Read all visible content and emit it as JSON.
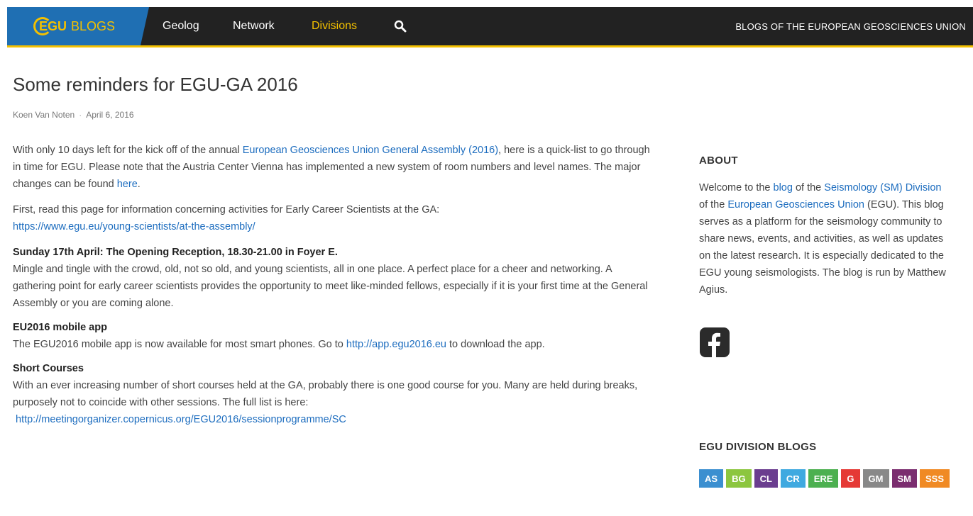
{
  "nav": {
    "logo_egu": "EGU",
    "logo_blogs": "BLOGS",
    "items": [
      {
        "label": "Geolog"
      },
      {
        "label": "Network"
      },
      {
        "label": "Divisions"
      }
    ],
    "right_text": "BLOGS OF THE EUROPEAN GEOSCIENCES UNION",
    "accent_color": "#f3c000",
    "brand_color": "#1f6fb3"
  },
  "post": {
    "title": "Some reminders for EGU-GA 2016",
    "author": "Koen Van Noten",
    "separator": "·",
    "date": "April 6, 2016",
    "intro": {
      "t1": "With only 10 days left for the kick off of the annual ",
      "link1": "European Geosciences Union General Assembly (2016)",
      "t2": ", here is a quick-list to go through in time for EGU. Please note that the Austria Center Vienna has implemented a new system of room numbers and level names. The major changes can be found ",
      "link2": "here",
      "t3": "."
    },
    "first": {
      "t1": "First, read this page for information concerning activities for Early Career Scientists at the GA:",
      "link": "https://www.egu.eu/young-scientists/at-the-assembly/"
    },
    "sections": [
      {
        "heading": "Sunday 17th April: The Opening Reception, 18.30-21.00 in Foyer E.",
        "text": "Mingle and tingle with the crowd, old, not so old, and young scientists, all in one place. A perfect place for a cheer and networking. A gathering point for early career scientists provides the opportunity to meet like-minded fellows, especially if it is your first time at the General Assembly or you are coming alone."
      },
      {
        "heading": "EU2016 mobile app",
        "t1": "The EGU2016 mobile app is now available for most smart phones. Go to ",
        "link": "http://app.egu2016.eu",
        "t2": "  to download the app."
      },
      {
        "heading": "Short Courses",
        "text": "With an ever increasing number of short courses held at the GA,  probably there is one good course for you. Many are held during breaks, purposely not to coincide with other sessions. The full list is here:",
        "link": "http://meetingorganizer.copernicus.org/EGU2016/sessionprogramme/SC"
      }
    ]
  },
  "sidebar": {
    "about_heading": "ABOUT",
    "about": {
      "t1": "Welcome to the ",
      "link1": "blog",
      "t2": " of the ",
      "link2": "Seismology (SM) Division",
      "t3": " of the ",
      "link3": "European Geosciences Union",
      "t4": " (EGU). This blog serves as a platform for the seismology community to share news, events, and activities, as well as updates on the latest research. It is especially dedicated to the EGU young seismologists. The blog is run by Matthew Agius."
    },
    "facebook_icon": "facebook-icon",
    "division_heading": "EGU DIVISION BLOGS",
    "divisions": [
      {
        "label": "AS",
        "color": "#3b8fd0"
      },
      {
        "label": "BG",
        "color": "#8cc63f"
      },
      {
        "label": "CL",
        "color": "#6a3d8f"
      },
      {
        "label": "CR",
        "color": "#3fa9e0"
      },
      {
        "label": "ERE",
        "color": "#4cb050"
      },
      {
        "label": "G",
        "color": "#e53935"
      },
      {
        "label": "GM",
        "color": "#888888"
      },
      {
        "label": "SM",
        "color": "#7b2d6f"
      },
      {
        "label": "SSS",
        "color": "#f08a24"
      }
    ]
  }
}
